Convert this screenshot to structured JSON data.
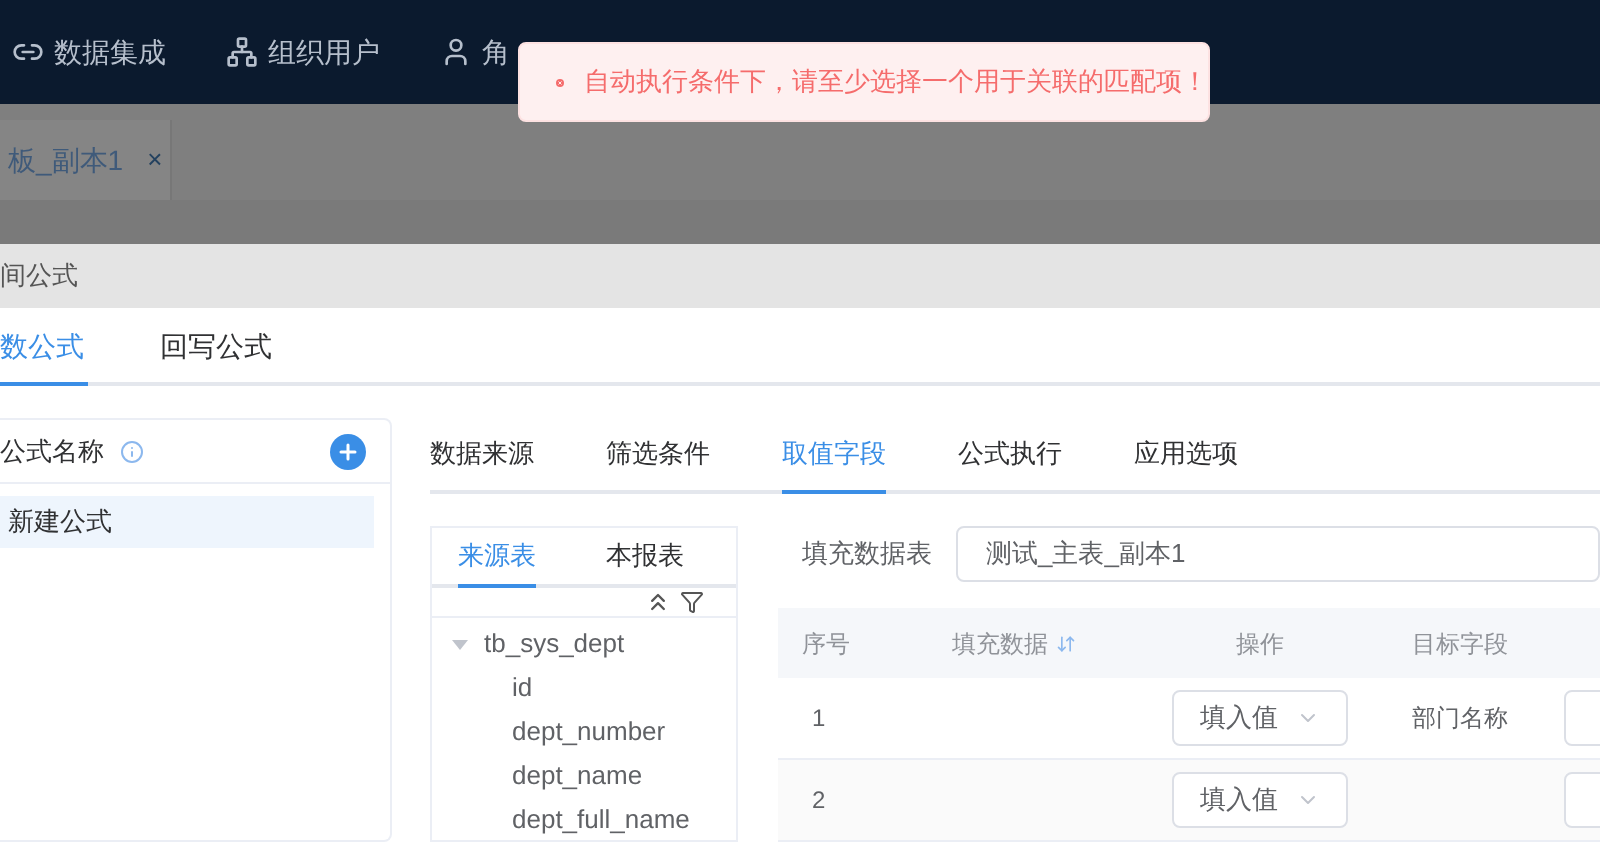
{
  "nav": [
    {
      "label": "数据集成"
    },
    {
      "label": "组织用户"
    },
    {
      "label": "角"
    }
  ],
  "toast": {
    "kind": "error",
    "message": "自动执行条件下，请至少选择一个用于关联的匹配项！"
  },
  "doc_tab": {
    "label": "板_副本1",
    "close": "×"
  },
  "dialog": {
    "title": "间公式",
    "tabs": [
      {
        "label": "数公式",
        "selected": true
      },
      {
        "label": "回写公式",
        "selected": false
      }
    ],
    "formula_list": {
      "header": "公式名称",
      "items": [
        {
          "label": "新建公式",
          "selected": true
        }
      ]
    },
    "sub_tabs": [
      {
        "label": "数据来源",
        "selected": false
      },
      {
        "label": "筛选条件",
        "selected": false
      },
      {
        "label": "取值字段",
        "selected": true
      },
      {
        "label": "公式执行",
        "selected": false
      },
      {
        "label": "应用选项",
        "selected": false
      }
    ],
    "source_tabs": [
      {
        "label": "来源表",
        "selected": true
      },
      {
        "label": "本报表",
        "selected": false
      }
    ],
    "tree": [
      {
        "label": "tb_sys_dept",
        "expanded": true,
        "children": [
          {
            "label": "id"
          },
          {
            "label": "dept_number"
          },
          {
            "label": "dept_name"
          },
          {
            "label": "dept_full_name"
          }
        ]
      }
    ],
    "fill_table": {
      "label": "填充数据表",
      "value": "测试_主表_副本1"
    },
    "table": {
      "columns": [
        "序号",
        "填充数据",
        "操作",
        "目标字段"
      ],
      "rows": [
        {
          "index": "1",
          "operation": "填入值",
          "target": "部门名称"
        },
        {
          "index": "2",
          "operation": "填入值"
        }
      ]
    }
  }
}
